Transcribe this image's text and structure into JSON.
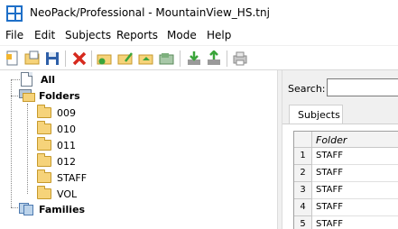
{
  "window": {
    "title": "NeoPack/Professional - MountainView_HS.tnj"
  },
  "menu": [
    "File",
    "Edit",
    "Subjects",
    "Reports",
    "Mode",
    "Help"
  ],
  "toolbar": {
    "icons": [
      "new-icon",
      "open-icon",
      "save-icon",
      "delete-icon",
      "add-folder-icon",
      "edit-folder-icon",
      "folder-home-icon",
      "folder-move-icon",
      "import-icon",
      "export-icon",
      "print-icon"
    ]
  },
  "tree": {
    "all": "All",
    "folders": "Folders",
    "folder_items": [
      "009",
      "010",
      "011",
      "012",
      "STAFF",
      "VOL"
    ],
    "families": "Families"
  },
  "right": {
    "search_label": "Search:",
    "search_value": "",
    "tab_label": "Subjects",
    "grid": {
      "column": "Folder",
      "rows": [
        {
          "num": "1",
          "folder": "STAFF"
        },
        {
          "num": "2",
          "folder": "STAFF"
        },
        {
          "num": "3",
          "folder": "STAFF"
        },
        {
          "num": "4",
          "folder": "STAFF"
        },
        {
          "num": "5",
          "folder": "STAFF"
        }
      ]
    }
  },
  "colors": {
    "accent": "#1e6fc8",
    "folder": "#f6d37a"
  }
}
